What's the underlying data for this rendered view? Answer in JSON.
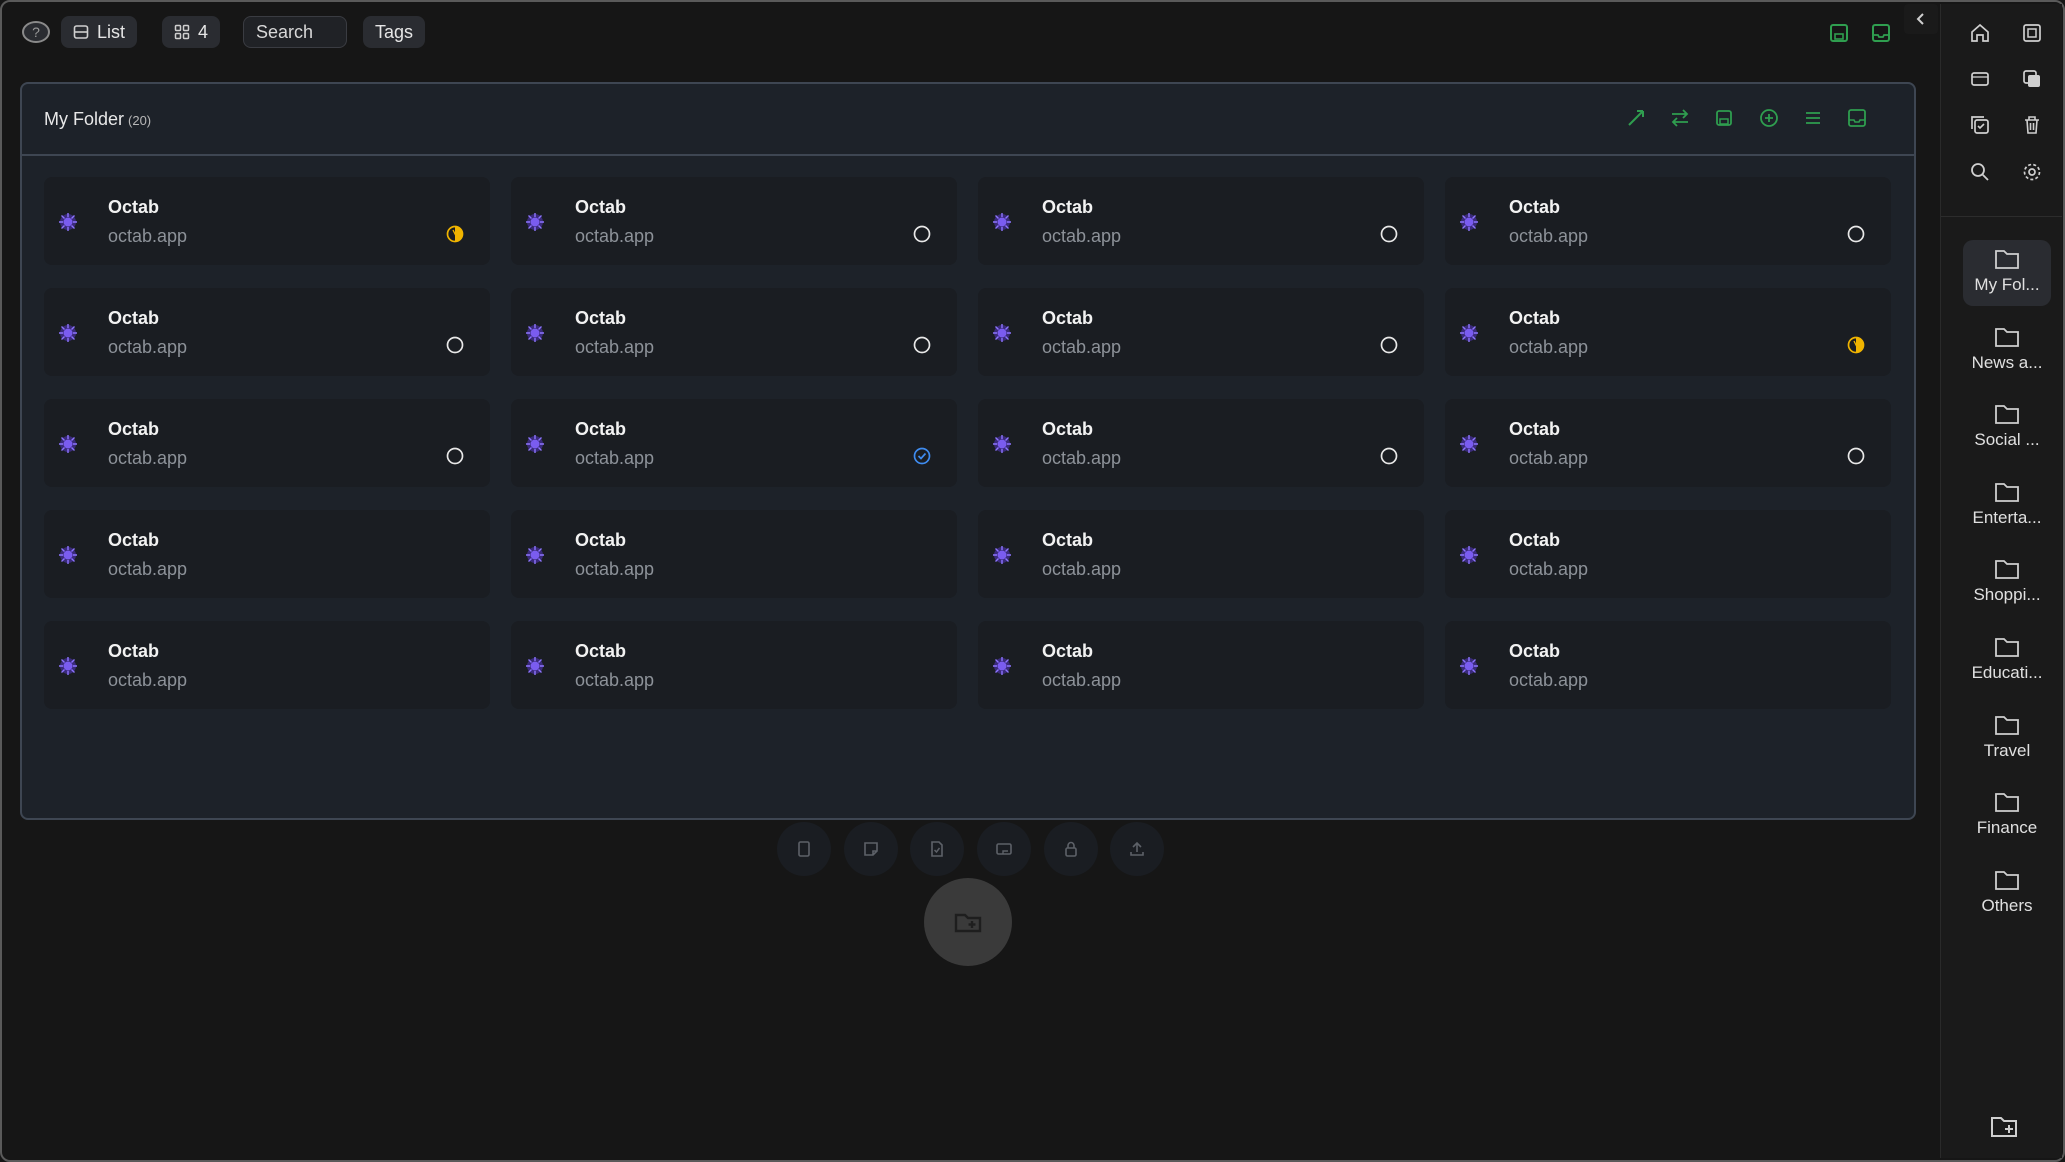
{
  "toolbar": {
    "help": "?",
    "list_label": "List",
    "grid_count": "4",
    "search_placeholder": "Search",
    "tags_label": "Tags"
  },
  "panel": {
    "title": "My Folder",
    "count": "(20)"
  },
  "cards": [
    {
      "name": "Octab",
      "url": "octab.app",
      "status": "partial"
    },
    {
      "name": "Octab",
      "url": "octab.app",
      "status": "empty"
    },
    {
      "name": "Octab",
      "url": "octab.app",
      "status": "empty"
    },
    {
      "name": "Octab",
      "url": "octab.app",
      "status": "empty"
    },
    {
      "name": "Octab",
      "url": "octab.app",
      "status": "empty"
    },
    {
      "name": "Octab",
      "url": "octab.app",
      "status": "empty"
    },
    {
      "name": "Octab",
      "url": "octab.app",
      "status": "empty"
    },
    {
      "name": "Octab",
      "url": "octab.app",
      "status": "partial"
    },
    {
      "name": "Octab",
      "url": "octab.app",
      "status": "empty"
    },
    {
      "name": "Octab",
      "url": "octab.app",
      "status": "checked"
    },
    {
      "name": "Octab",
      "url": "octab.app",
      "status": "empty"
    },
    {
      "name": "Octab",
      "url": "octab.app",
      "status": "empty"
    },
    {
      "name": "Octab",
      "url": "octab.app",
      "status": "none"
    },
    {
      "name": "Octab",
      "url": "octab.app",
      "status": "none"
    },
    {
      "name": "Octab",
      "url": "octab.app",
      "status": "none"
    },
    {
      "name": "Octab",
      "url": "octab.app",
      "status": "none"
    },
    {
      "name": "Octab",
      "url": "octab.app",
      "status": "none"
    },
    {
      "name": "Octab",
      "url": "octab.app",
      "status": "none"
    },
    {
      "name": "Octab",
      "url": "octab.app",
      "status": "none"
    },
    {
      "name": "Octab",
      "url": "octab.app",
      "status": "none"
    }
  ],
  "sidebar": {
    "folders": [
      {
        "label": "My Fol...",
        "active": true
      },
      {
        "label": "News a..."
      },
      {
        "label": "Social ..."
      },
      {
        "label": "Enterta..."
      },
      {
        "label": "Shoppi..."
      },
      {
        "label": "Educati..."
      },
      {
        "label": "Travel"
      },
      {
        "label": "Finance"
      },
      {
        "label": "Others"
      }
    ]
  },
  "colors": {
    "accent_green": "#2f9e4f",
    "status_partial": "#f0b400",
    "status_checked": "#3f8cf0"
  }
}
